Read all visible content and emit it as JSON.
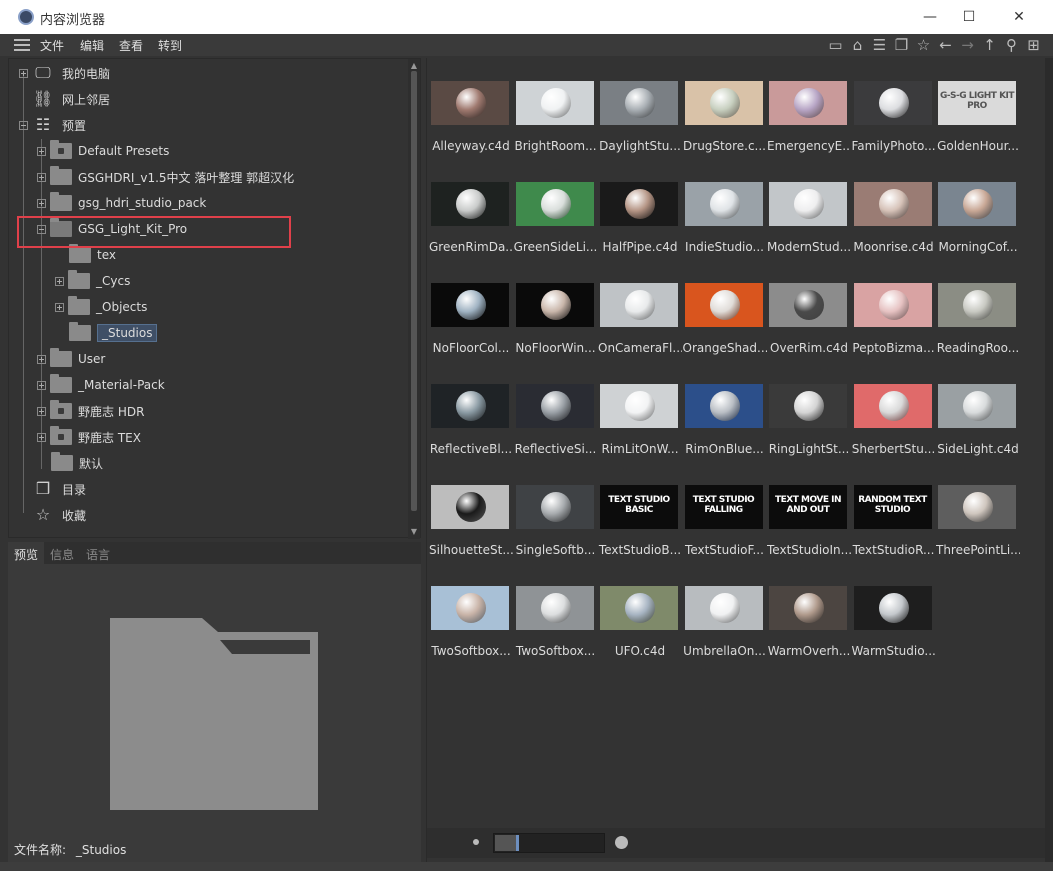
{
  "window": {
    "title": "内容浏览器",
    "minimize": "—",
    "maximize": "☐",
    "close": "✕"
  },
  "menu": {
    "items": [
      "文件",
      "编辑",
      "查看",
      "转到"
    ]
  },
  "toolbar": {
    "icons": [
      "panel-icon",
      "home-icon",
      "filter-icon",
      "book-icon",
      "star-icon",
      "back-icon",
      "forward-icon",
      "up-icon",
      "search-icon",
      "add-icon"
    ]
  },
  "tree": {
    "my_computer": "我的电脑",
    "network": "网上邻居",
    "presets": "预置",
    "default_presets": "Default Presets",
    "gsghdri": "GSGHDRI_v1.5中文  落叶整理 郭超汉化",
    "gsg_hdri_studio_pack": "gsg_hdri_studio_pack",
    "gsg_light_kit_pro": "GSG_Light_Kit_Pro",
    "tex": "tex",
    "cycs": "_Cycs",
    "objects": "_Objects",
    "studios": "_Studios",
    "user": "User",
    "material_pack": "_Material-Pack",
    "hdr": "野鹿志 HDR",
    "tex2": "野鹿志 TEX",
    "default": "默认",
    "catalog": "目录",
    "favorites": "收藏"
  },
  "bottom_tabs": [
    "预览",
    "信息",
    "语言"
  ],
  "filename": {
    "label": "文件名称:",
    "value": "_Studios"
  },
  "files": [
    {
      "name": "Alleyway.c4d",
      "bg": "#5a4a44",
      "sphere": "#a07a70"
    },
    {
      "name": "BrightRoom...",
      "bg": "#cfd3d6",
      "sphere": "#f0f2f3"
    },
    {
      "name": "DaylightStu...",
      "bg": "#7a7f84",
      "sphere": "#aab0b5"
    },
    {
      "name": "DrugStore.c...",
      "bg": "#d9c2a8",
      "sphere": "#c8d0c0"
    },
    {
      "name": "EmergencyE...",
      "bg": "#c99a9a",
      "sphere": "#b8a6c6"
    },
    {
      "name": "FamilyPhoto...",
      "bg": "#3b3b3d",
      "sphere": "#dcdde0"
    },
    {
      "name": "GoldenHour...",
      "bg": "#dadada",
      "sphere": "#dadada",
      "text": "G-S-G LIGHT KIT PRO"
    },
    {
      "name": "GreenRimDa...",
      "bg": "#1e2220",
      "sphere": "#c9cbca"
    },
    {
      "name": "GreenSideLi...",
      "bg": "#3f8a4c",
      "sphere": "#d9dedb"
    },
    {
      "name": "HalfPipe.c4d",
      "bg": "#1a1a1a",
      "sphere": "#b59585"
    },
    {
      "name": "IndieStudio...",
      "bg": "#9aa2a8",
      "sphere": "#dfe3e6"
    },
    {
      "name": "ModernStud...",
      "bg": "#c2c6c9",
      "sphere": "#eeeeef"
    },
    {
      "name": "Moonrise.c4d",
      "bg": "#9a7c74",
      "sphere": "#d6c2b8"
    },
    {
      "name": "MorningCof...",
      "bg": "#7a8590",
      "sphere": "#c9a896"
    },
    {
      "name": "NoFloorCol...",
      "bg": "#0a0a0a",
      "sphere": "#9fb2c2"
    },
    {
      "name": "NoFloorWin...",
      "bg": "#0a0a0a",
      "sphere": "#c9b6aa"
    },
    {
      "name": "OnCameraFl...",
      "bg": "#bfc3c6",
      "sphere": "#e8eaeb"
    },
    {
      "name": "OrangeShad...",
      "bg": "#d9551e",
      "sphere": "#e0dcd8"
    },
    {
      "name": "OverRim.c4d",
      "bg": "#8c8c8c",
      "sphere": "#4a4a4a"
    },
    {
      "name": "PeptoBizma...",
      "bg": "#d9a3a3",
      "sphere": "#e6c2c2"
    },
    {
      "name": "ReadingRoo...",
      "bg": "#8b8d84",
      "sphere": "#c8c9c2"
    },
    {
      "name": "ReflectiveBl...",
      "bg": "#1f2326",
      "sphere": "#8a9aa3"
    },
    {
      "name": "ReflectiveSi...",
      "bg": "#2a2c33",
      "sphere": "#9aa0a6"
    },
    {
      "name": "RimLitOnW...",
      "bg": "#cfd2d4",
      "sphere": "#f2f3f4"
    },
    {
      "name": "RimOnBlue...",
      "bg": "#2c4f8a",
      "sphere": "#b9bec4"
    },
    {
      "name": "RingLightSt...",
      "bg": "#3a3a3a",
      "sphere": "#d4d4d4"
    },
    {
      "name": "SherbertStu...",
      "bg": "#e06a6a",
      "sphere": "#d9d9d9"
    },
    {
      "name": "SideLight.c4d",
      "bg": "#9aa0a3",
      "sphere": "#d8dbdc"
    },
    {
      "name": "SilhouetteSt...",
      "bg": "#bdbdbd",
      "sphere": "#1a1a1a"
    },
    {
      "name": "SingleSoftb...",
      "bg": "#3f4245",
      "sphere": "#a8acaf"
    },
    {
      "name": "TextStudioB...",
      "bg": "#0c0c0c",
      "sphere": "#0c0c0c",
      "text": "TEXT STUDIO BASIC"
    },
    {
      "name": "TextStudioF...",
      "bg": "#0c0c0c",
      "sphere": "#0c0c0c",
      "text": "TEXT STUDIO FALLING"
    },
    {
      "name": "TextStudioIn...",
      "bg": "#0c0c0c",
      "sphere": "#0c0c0c",
      "text": "TEXT MOVE IN AND OUT"
    },
    {
      "name": "TextStudioR...",
      "bg": "#0c0c0c",
      "sphere": "#0c0c0c",
      "text": "RANDOM TEXT STUDIO"
    },
    {
      "name": "ThreePointLi...",
      "bg": "#5e5e5e",
      "sphere": "#cfc6be"
    },
    {
      "name": "TwoSoftbox...",
      "bg": "#a8c0d6",
      "sphere": "#c9b4a8"
    },
    {
      "name": "TwoSoftbox...",
      "bg": "#8f9396",
      "sphere": "#dcdedf"
    },
    {
      "name": "UFO.c4d",
      "bg": "#7f8a6a",
      "sphere": "#a7b4c2"
    },
    {
      "name": "UmbrellaOn...",
      "bg": "#b8bcbf",
      "sphere": "#f0f1f2"
    },
    {
      "name": "WarmOverh...",
      "bg": "#4c4541",
      "sphere": "#b09a8c"
    },
    {
      "name": "WarmStudio...",
      "bg": "#1e1e1e",
      "sphere": "#c4c8cc"
    }
  ],
  "colors": {
    "highlight": "#e0404a",
    "selection": "#3f4f66",
    "background": "#333333"
  }
}
